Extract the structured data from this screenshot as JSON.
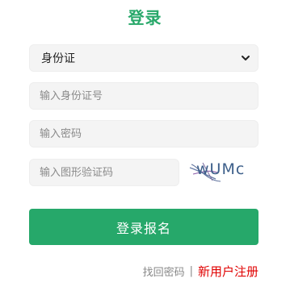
{
  "title": "登录",
  "id_type_select": {
    "selected": "身份证",
    "icon": "chevron-down-icon"
  },
  "id_number_input": {
    "placeholder": "输入身份证号",
    "value": ""
  },
  "password_input": {
    "placeholder": "输入密码",
    "value": ""
  },
  "captcha_input": {
    "placeholder": "输入图形验证码",
    "value": ""
  },
  "captcha_image": {
    "text": "wUMc",
    "color": "#3d5f8a"
  },
  "submit_button": {
    "label": "登录报名"
  },
  "links": {
    "forgot_password": "找回密码",
    "separator": "|",
    "new_user_register": "新用户注册"
  },
  "colors": {
    "accent": "#26a86a",
    "link_red": "#e00000"
  }
}
